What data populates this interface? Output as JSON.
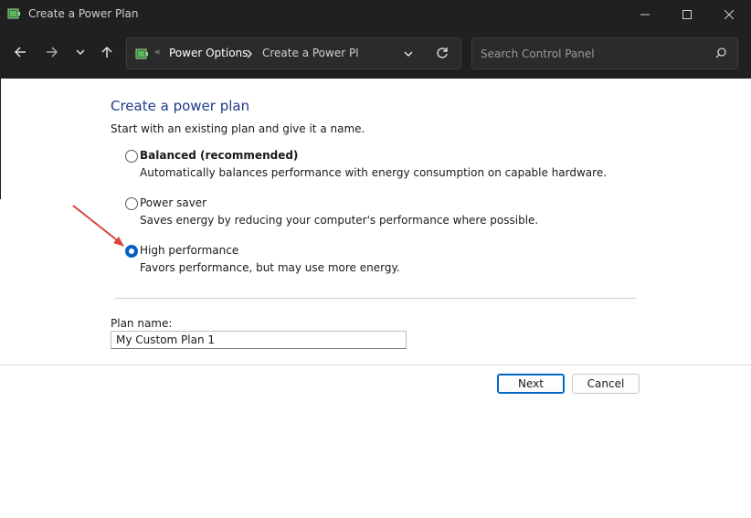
{
  "window": {
    "title": "Create a Power Plan",
    "controls": [
      "minimize-icon",
      "maximize-icon",
      "close-icon"
    ]
  },
  "navigation": {
    "buttons": [
      "back-arrow-icon",
      "forward-arrow-icon",
      "recent-dropdown-icon",
      "up-arrow-icon"
    ],
    "breadcrumb": {
      "overflow": "«",
      "root": "Power Options",
      "current": "Create a Power Plan"
    },
    "search_placeholder": "Search Control Panel"
  },
  "main": {
    "heading": "Create a power plan",
    "intro": "Start with an existing plan and give it a name.",
    "options": [
      {
        "label": "Balanced (recommended)",
        "description": "Automatically balances performance with energy consumption on capable hardware.",
        "selected": false
      },
      {
        "label": "Power saver",
        "description": "Saves energy by reducing your computer's performance where possible.",
        "selected": false
      },
      {
        "label": "High performance",
        "description": "Favors performance, but may use more energy.",
        "selected": true
      }
    ],
    "plan_name_label": "Plan name:",
    "plan_name_value": "My Custom Plan 1"
  },
  "footer": {
    "next_label": "Next",
    "cancel_label": "Cancel"
  },
  "colors": {
    "titlebar": "#202020",
    "heading": "#1e3a8a",
    "accent": "#0060c0",
    "annotation_arrow": "#d9443b"
  }
}
